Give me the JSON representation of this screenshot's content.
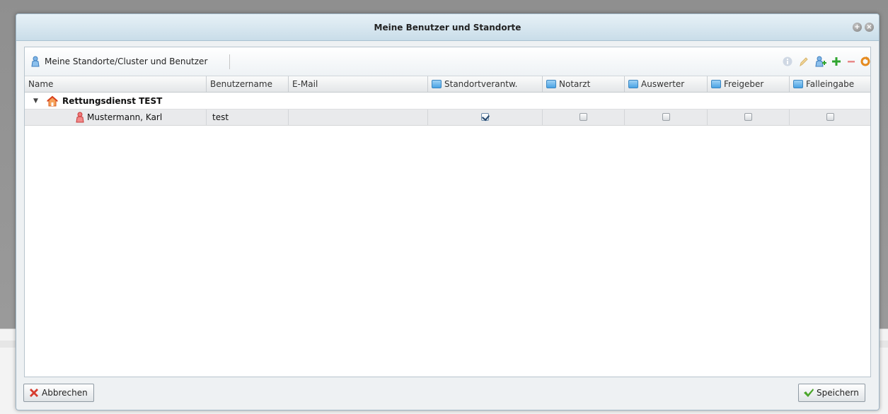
{
  "dialog": {
    "title": "Meine Benutzer und Standorte",
    "window_controls": [
      {
        "name": "add",
        "glyph": "+"
      },
      {
        "name": "close",
        "glyph": "×"
      }
    ]
  },
  "panel": {
    "title": "Meine Standorte/Cluster und Benutzer",
    "title_icon": "person-blue-icon",
    "toolbar_icons": [
      "info-icon",
      "edit-pencil-icon",
      "add-user-icon",
      "add-icon",
      "remove-icon",
      "refresh-icon"
    ]
  },
  "grid": {
    "columns": [
      {
        "label": "Name",
        "icon": false
      },
      {
        "label": "Benutzername",
        "icon": false
      },
      {
        "label": "E-Mail",
        "icon": false
      },
      {
        "label": "Standortverantw.",
        "icon": true
      },
      {
        "label": "Notarzt",
        "icon": true
      },
      {
        "label": "Auswerter",
        "icon": true
      },
      {
        "label": "Freigeber",
        "icon": true
      },
      {
        "label": "Falleingabe",
        "icon": true
      }
    ],
    "group": {
      "label": "Rettungsdienst TEST",
      "expanded": true,
      "icon": "house-icon"
    },
    "rows": [
      {
        "name": "Mustermann, Karl",
        "username": "test",
        "email": "",
        "standortverantw": true,
        "notarzt": false,
        "auswerter": false,
        "freigeber": false,
        "falleingabe": false
      }
    ]
  },
  "buttons": {
    "cancel_label": "Abbrechen",
    "save_label": "Speichern"
  },
  "colors": {
    "titlebar": "#c9dde9",
    "check_mark": "#24466b",
    "add_green": "#2fa52f",
    "remove_red": "#e05454",
    "refresh_orange": "#e58a1f"
  }
}
